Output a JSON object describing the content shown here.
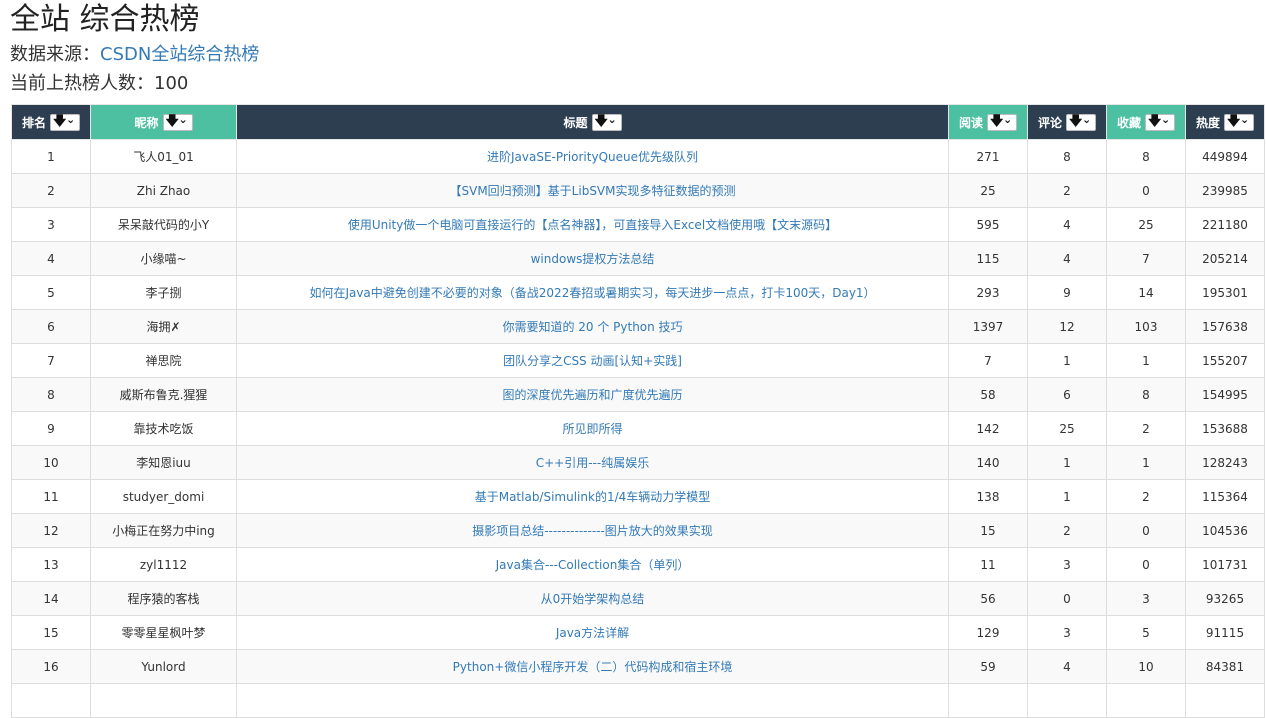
{
  "page": {
    "title": "全站 综合热榜",
    "source_prefix": "数据来源：",
    "source_link": "CSDN全站综合热榜",
    "count_label": "当前上热榜人数：100"
  },
  "table": {
    "headers": [
      "排名",
      "昵称",
      "标题",
      "阅读",
      "评论",
      "收藏",
      "热度"
    ],
    "sort_icon": "sort-down-arrow-with-chevron",
    "colors": {
      "header_bg": "#2c3e50",
      "header_sorted_bg": "#4cc0a0",
      "link": "#337ab7"
    },
    "rows": [
      {
        "rank": "1",
        "name": "飞人01_01",
        "title": "进阶JavaSE-PriorityQueue优先级队列",
        "read": "271",
        "comment": "8",
        "fav": "8",
        "heat": "449894"
      },
      {
        "rank": "2",
        "name": "Zhi Zhao",
        "title": "【SVM回归预测】基于LibSVM实现多特征数据的预测",
        "read": "25",
        "comment": "2",
        "fav": "0",
        "heat": "239985"
      },
      {
        "rank": "3",
        "name": "呆呆敲代码的小Y",
        "title": "使用Unity做一个电脑可直接运行的【点名神器】，可直接导入Excel文档使用哦【文末源码】",
        "read": "595",
        "comment": "4",
        "fav": "25",
        "heat": "221180"
      },
      {
        "rank": "4",
        "name": "小缘喵~",
        "title": "windows提权方法总结",
        "read": "115",
        "comment": "4",
        "fav": "7",
        "heat": "205214"
      },
      {
        "rank": "5",
        "name": "李子捌",
        "title": "如何在Java中避免创建不必要的对象（备战2022春招或暑期实习，每天进步一点点，打卡100天，Day1）",
        "read": "293",
        "comment": "9",
        "fav": "14",
        "heat": "195301"
      },
      {
        "rank": "6",
        "name": "海拥✗",
        "title": "你需要知道的 20 个 Python 技巧",
        "read": "1397",
        "comment": "12",
        "fav": "103",
        "heat": "157638"
      },
      {
        "rank": "7",
        "name": "禅思院",
        "title": "团队分享之CSS 动画[认知+实践]",
        "read": "7",
        "comment": "1",
        "fav": "1",
        "heat": "155207"
      },
      {
        "rank": "8",
        "name": "威斯布鲁克.猩猩",
        "title": "图的深度优先遍历和广度优先遍历",
        "read": "58",
        "comment": "6",
        "fav": "8",
        "heat": "154995"
      },
      {
        "rank": "9",
        "name": "靠技术吃饭",
        "title": "所见即所得",
        "read": "142",
        "comment": "25",
        "fav": "2",
        "heat": "153688"
      },
      {
        "rank": "10",
        "name": "李知恩iuu",
        "title": "C++引用---纯属娱乐",
        "read": "140",
        "comment": "1",
        "fav": "1",
        "heat": "128243"
      },
      {
        "rank": "11",
        "name": "studyer_domi",
        "title": "基于Matlab/Simulink的1/4车辆动力学模型",
        "read": "138",
        "comment": "1",
        "fav": "2",
        "heat": "115364"
      },
      {
        "rank": "12",
        "name": "小梅正在努力中ing",
        "title": "摄影项目总结--------------图片放大的效果实现",
        "read": "15",
        "comment": "2",
        "fav": "0",
        "heat": "104536"
      },
      {
        "rank": "13",
        "name": "zyl1112",
        "title": "Java集合---Collection集合（单列）",
        "read": "11",
        "comment": "3",
        "fav": "0",
        "heat": "101731"
      },
      {
        "rank": "14",
        "name": "程序猿的客栈",
        "title": "从0开始学架构总结",
        "read": "56",
        "comment": "0",
        "fav": "3",
        "heat": "93265"
      },
      {
        "rank": "15",
        "name": "零零星星枫叶梦",
        "title": "Java方法详解",
        "read": "129",
        "comment": "3",
        "fav": "5",
        "heat": "91115"
      },
      {
        "rank": "16",
        "name": "Yunlord",
        "title": "Python+微信小程序开发（二）代码构成和宿主环境",
        "read": "59",
        "comment": "4",
        "fav": "10",
        "heat": "84381"
      },
      {
        "rank": "",
        "name": "",
        "title": "",
        "read": "",
        "comment": "",
        "fav": "",
        "heat": ""
      }
    ]
  }
}
